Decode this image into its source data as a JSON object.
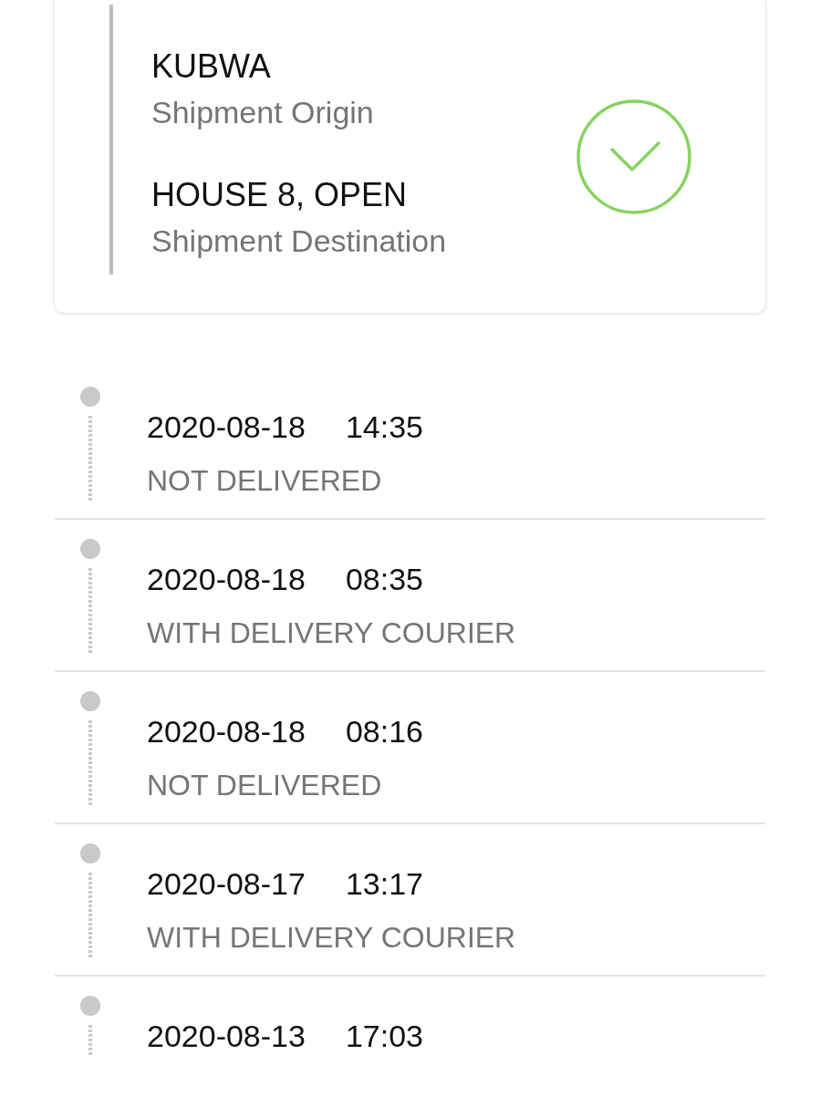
{
  "shipment": {
    "origin": {
      "name": "KUBWA",
      "label": "Shipment Origin"
    },
    "destination": {
      "name": "HOUSE 8, OPEN",
      "label": "Shipment Destination"
    }
  },
  "events": [
    {
      "date": "2020-08-18",
      "time": "14:35",
      "status": "NOT DELIVERED"
    },
    {
      "date": "2020-08-18",
      "time": "08:35",
      "status": "WITH DELIVERY COURIER"
    },
    {
      "date": "2020-08-18",
      "time": "08:16",
      "status": "NOT DELIVERED"
    },
    {
      "date": "2020-08-17",
      "time": "13:17",
      "status": "WITH DELIVERY COURIER"
    },
    {
      "date": "2020-08-13",
      "time": "17:03"
    }
  ]
}
